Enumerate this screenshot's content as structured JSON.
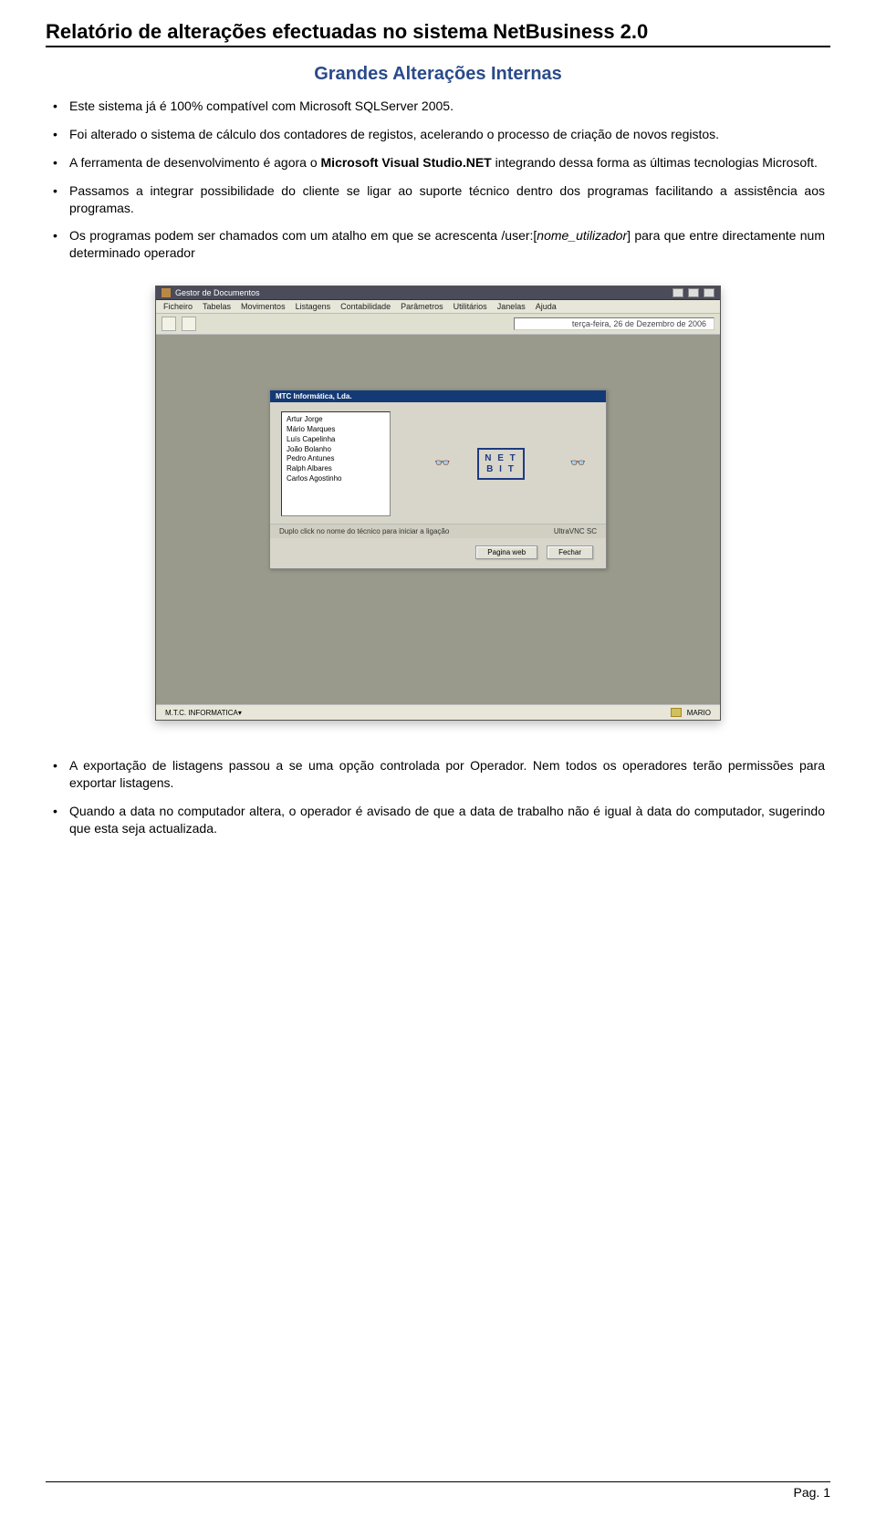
{
  "doc": {
    "title": "Relatório de alterações efectuadas no sistema NetBusiness 2.0",
    "section_title": "Grandes Alterações Internas",
    "bullets_top": [
      {
        "t": "Este sistema já é 100% compatível com Microsoft SQLServer 2005."
      },
      {
        "t": "Foi alterado o sistema de cálculo dos contadores de registos, acelerando o processo de criação de novos registos."
      },
      {
        "pre": "A ferramenta de desenvolvimento é agora o ",
        "b": "Microsoft Visual Studio.NET",
        "post": " integrando dessa forma as últimas tecnologias Microsoft."
      },
      {
        "t": "Passamos a integrar possibilidade do cliente se ligar ao suporte técnico dentro dos programas facilitando a assistência aos programas."
      },
      {
        "pre": "Os programas podem ser chamados com um atalho em que se acrescenta /user:[",
        "i": "nome_utilizador",
        "post": "] para que entre directamente num determinado operador"
      }
    ],
    "bullets_bottom": [
      {
        "t": "A exportação de listagens passou a se uma opção controlada por Operador. Nem todos os operadores terão permissões para exportar listagens."
      },
      {
        "t": "Quando a data no computador altera, o operador é avisado de que a data de trabalho não é igual à data do computador, sugerindo que esta seja actualizada."
      }
    ],
    "footer": "Pag. 1"
  },
  "app": {
    "title": "Gestor de Documentos",
    "menus": [
      "Ficheiro",
      "Tabelas",
      "Movimentos",
      "Listagens",
      "Contabilidade",
      "Parâmetros",
      "Utilitários",
      "Janelas",
      "Ajuda"
    ],
    "date": "terça-feira, 26 de Dezembro de 2006",
    "inner_title": "MTC Informática, Lda.",
    "technicians": [
      "Artur Jorge",
      "Mário Marques",
      "Luís Capelinha",
      "João Bolanho",
      "Pedro Antunes",
      "Ralph Albares",
      "Carlos Agostinho"
    ],
    "hint": "Duplo click no nome do técnico para iniciar a ligação",
    "hint_right": "UltraVNC SC",
    "btn_web": "Pagina web",
    "btn_close": "Fechar",
    "status_left": "M.T.C. INFORMATICA  ",
    "status_right": "MARIO",
    "logo_line1": "N E T",
    "logo_line2": "B I T"
  }
}
